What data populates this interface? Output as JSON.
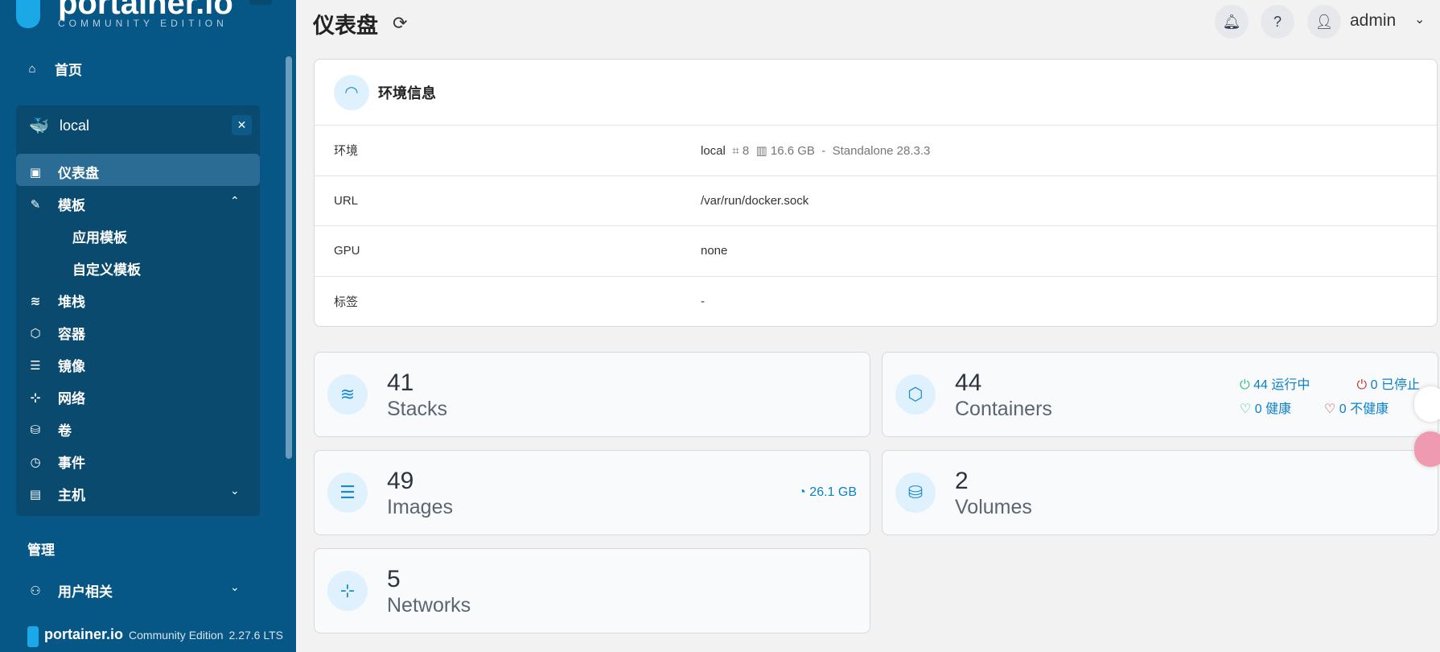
{
  "sidebar": {
    "logo": "portainer.io",
    "logo_sub": "COMMUNITY EDITION",
    "home": "首页",
    "env_name": "local",
    "items": [
      "仪表盘",
      "模板",
      "应用模板",
      "自定义模板",
      "堆栈",
      "容器",
      "镜像",
      "网络",
      "卷",
      "事件",
      "主机"
    ],
    "section": "管理",
    "users": "用户相关",
    "footer_brand": "portainer.io",
    "footer_edition": "Community Edition",
    "footer_version": "2.27.6 LTS"
  },
  "header": {
    "title": "仪表盘",
    "user": "admin"
  },
  "info": {
    "title": "环境信息",
    "rows": [
      {
        "k": "环境",
        "v": "local",
        "cpu": "8",
        "mem": "16.6 GB",
        "sep": "-",
        "type": "Standalone 28.3.3"
      },
      {
        "k": "URL",
        "v": "/var/run/docker.sock"
      },
      {
        "k": "GPU",
        "v": "none"
      },
      {
        "k": "标签",
        "v": "-"
      }
    ]
  },
  "stats": {
    "stacks": {
      "n": "41",
      "l": "Stacks"
    },
    "containers": {
      "n": "44",
      "l": "Containers",
      "running": "44 运行中",
      "stopped": "0 已停止",
      "healthy": "0 健康",
      "unhealthy": "0 不健康"
    },
    "images": {
      "n": "49",
      "l": "Images",
      "size": "26.1 GB"
    },
    "volumes": {
      "n": "2",
      "l": "Volumes"
    },
    "networks": {
      "n": "5",
      "l": "Networks"
    }
  },
  "colors": {
    "sidebar": "#065686",
    "accent": "#0b82c8",
    "running": "#2ec27e",
    "stopped": "#c0392b"
  }
}
